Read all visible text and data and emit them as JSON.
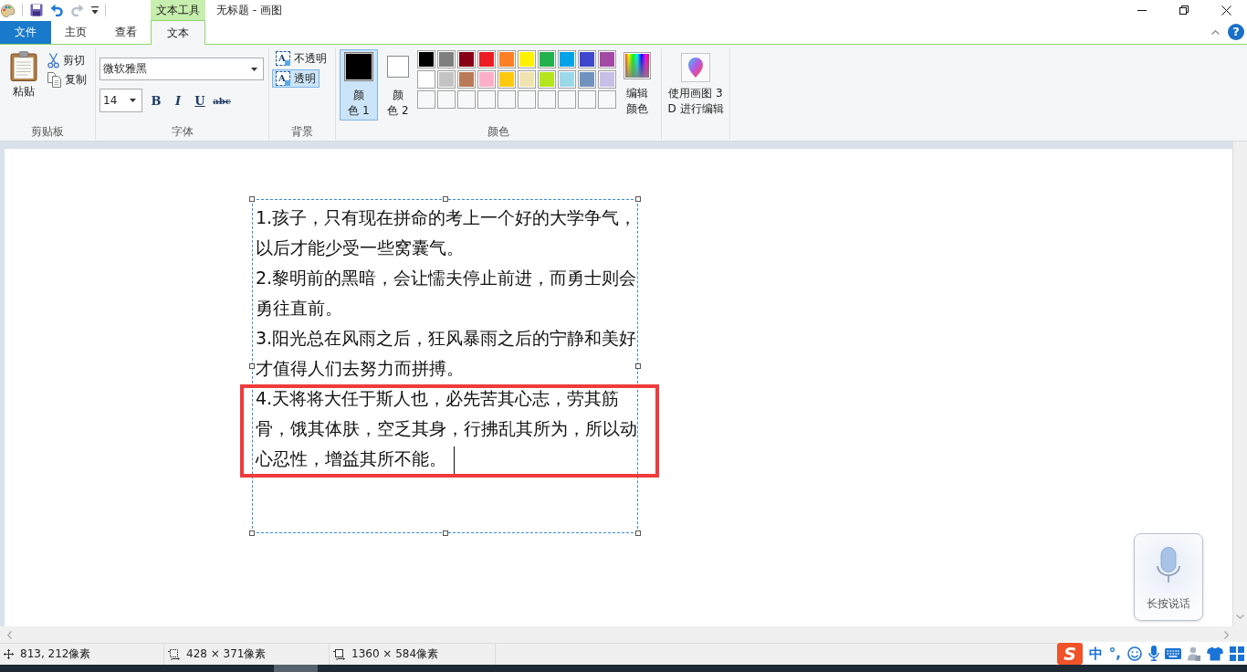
{
  "title_bar": {
    "quick_access": [
      {
        "kind": "app",
        "disabled": false
      },
      {
        "kind": "save",
        "disabled": false
      },
      {
        "kind": "undo",
        "disabled": false
      },
      {
        "kind": "redo",
        "disabled": true
      },
      {
        "kind": "customize",
        "disabled": false
      }
    ],
    "context_label": "文本工具",
    "title": "无标题 - 画图"
  },
  "ribbon": {
    "file_menu": "文件",
    "tabs": [
      {
        "label": "主页",
        "selected": false
      },
      {
        "label": "查看",
        "selected": false
      },
      {
        "label": "文本",
        "selected": true
      }
    ],
    "help": "?",
    "clipboard": {
      "label": "剪贴板",
      "paste": "粘贴",
      "cut": "剪切",
      "copy": "复制"
    },
    "font": {
      "label": "字体",
      "family": "微软雅黑",
      "size": "14",
      "styles": [
        {
          "kind": "bold",
          "text": "B"
        },
        {
          "kind": "italic",
          "text": "I"
        },
        {
          "kind": "underline",
          "text": "U"
        },
        {
          "kind": "strike",
          "text": "abc"
        }
      ]
    },
    "background": {
      "label": "背景",
      "options": [
        {
          "icon_text": "A",
          "label": "不透明",
          "selected": false
        },
        {
          "icon_text": "A",
          "label": "透明",
          "selected": true
        }
      ]
    },
    "colors": {
      "label": "颜色",
      "primary": {
        "lines": [
          "颜",
          "色 1"
        ],
        "color": "#000000",
        "selected": true
      },
      "secondary": {
        "lines": [
          "颜",
          "色 2"
        ],
        "color": "#ffffff",
        "selected": false
      },
      "palette": [
        {
          "kind": "color",
          "color": "#000000"
        },
        {
          "kind": "color",
          "color": "#7f7f7f"
        },
        {
          "kind": "color",
          "color": "#880015"
        },
        {
          "kind": "color",
          "color": "#ed1c24"
        },
        {
          "kind": "color",
          "color": "#ff7f27"
        },
        {
          "kind": "color",
          "color": "#fff200"
        },
        {
          "kind": "color",
          "color": "#22b14c"
        },
        {
          "kind": "color",
          "color": "#00a2e8"
        },
        {
          "kind": "color",
          "color": "#3f48cc"
        },
        {
          "kind": "color",
          "color": "#a349a4"
        },
        {
          "kind": "color",
          "color": "#ffffff"
        },
        {
          "kind": "color",
          "color": "#c3c3c3"
        },
        {
          "kind": "color",
          "color": "#b97a57"
        },
        {
          "kind": "color",
          "color": "#ffaec9"
        },
        {
          "kind": "color",
          "color": "#ffc90e"
        },
        {
          "kind": "color",
          "color": "#efe4b0"
        },
        {
          "kind": "color",
          "color": "#b5e61d"
        },
        {
          "kind": "color",
          "color": "#99d9ea"
        },
        {
          "kind": "color",
          "color": "#7092be"
        },
        {
          "kind": "color",
          "color": "#c8bfe7"
        },
        {
          "kind": "empty"
        },
        {
          "kind": "empty"
        },
        {
          "kind": "empty"
        },
        {
          "kind": "empty"
        },
        {
          "kind": "empty"
        },
        {
          "kind": "empty"
        },
        {
          "kind": "empty"
        },
        {
          "kind": "empty"
        },
        {
          "kind": "empty"
        },
        {
          "kind": "empty"
        }
      ],
      "edit": [
        "编辑",
        "颜色"
      ]
    },
    "paint3d": {
      "lines": [
        "使用画图 3",
        "D 进行编辑"
      ]
    }
  },
  "canvas": {
    "paragraphs": [
      {
        "lines": [
          "1.孩子，只有现在拼命的考上一个好的大学争气，",
          "以后才能少受一些窝囊气。"
        ],
        "highlighted": false,
        "caret": false
      },
      {
        "lines": [
          "2.黎明前的黑暗，会让懦夫停止前进，而勇士则会",
          "勇往直前。"
        ],
        "highlighted": false,
        "caret": false
      },
      {
        "lines": [
          "3.阳光总在风雨之后，狂风暴雨之后的宁静和美好",
          "才值得人们去努力而拼搏。"
        ],
        "highlighted": false,
        "caret": false
      },
      {
        "lines": [
          "4.天将将大任于斯人也，必先苦其心志，劳其筋",
          "骨，饿其体肤，空乏其身，行拂乱其所为，所以动",
          "心忍性，增益其所不能。"
        ],
        "highlighted": true,
        "caret": true
      }
    ]
  },
  "voice_input": {
    "label": "长按说话"
  },
  "status_bar": [
    {
      "kind": "position",
      "text": "813, 212像素"
    },
    {
      "kind": "selection",
      "text": "428 × 371像素"
    },
    {
      "kind": "canvas",
      "text": "1360 × 584像素"
    }
  ],
  "ime_toolbar": [
    {
      "kind": "logo",
      "text": "S"
    },
    {
      "kind": "mode",
      "text": "中"
    },
    {
      "kind": "mode",
      "text": "°,"
    },
    {
      "kind": "smiley"
    },
    {
      "kind": "mic"
    },
    {
      "kind": "keyboard"
    },
    {
      "kind": "person"
    },
    {
      "kind": "shirt"
    },
    {
      "kind": "grid"
    }
  ]
}
